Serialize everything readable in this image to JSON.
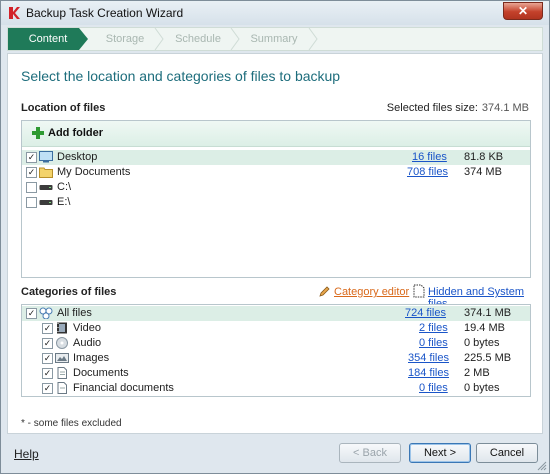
{
  "window": {
    "title": "Backup Task Creation Wizard",
    "close_label": "✕"
  },
  "steps": [
    "Content",
    "Storage",
    "Schedule",
    "Summary"
  ],
  "heading": "Select the location and categories of files to backup",
  "location": {
    "label": "Location of files",
    "selected_size_label": "Selected files size:",
    "selected_size_value": "374.1 MB",
    "add_folder_label": "Add folder",
    "rows": [
      {
        "name": "Desktop",
        "checked": "✓",
        "files": "16 files",
        "size": "81.8 KB",
        "icon": "desktop-icon"
      },
      {
        "name": "My Documents",
        "checked": "✓",
        "files": "708 files",
        "size": "374 MB",
        "icon": "folder-icon"
      },
      {
        "name": "C:\\",
        "checked": "",
        "files": "",
        "size": "",
        "icon": "drive-icon"
      },
      {
        "name": "E:\\",
        "checked": "",
        "files": "",
        "size": "",
        "icon": "drive-icon"
      }
    ]
  },
  "categories": {
    "label": "Categories of files",
    "editor_label": "Category editor",
    "hidden_label": "Hidden and System files",
    "rows": [
      {
        "name": "All files",
        "checked": "✓",
        "files": "724 files",
        "size": "374.1 MB",
        "icon": "all-files-icon"
      },
      {
        "name": "Video",
        "checked": "✓",
        "files": "2 files",
        "size": "19.4 MB",
        "icon": "film-icon"
      },
      {
        "name": "Audio",
        "checked": "✓",
        "files": "0 files",
        "size": "0 bytes",
        "icon": "audio-cd-icon"
      },
      {
        "name": "Images",
        "checked": "✓",
        "files": "354 files",
        "size": "225.5 MB",
        "icon": "image-icon"
      },
      {
        "name": "Documents",
        "checked": "✓",
        "files": "184 files",
        "size": "2 MB",
        "icon": "document-icon"
      },
      {
        "name": "Financial documents",
        "checked": "✓",
        "files": "0 files",
        "size": "0 bytes",
        "icon": "financial-document-icon"
      }
    ]
  },
  "note": "* - some files excluded",
  "footer": {
    "help": "Help",
    "back": "< Back",
    "next": "Next >",
    "cancel": "Cancel"
  }
}
